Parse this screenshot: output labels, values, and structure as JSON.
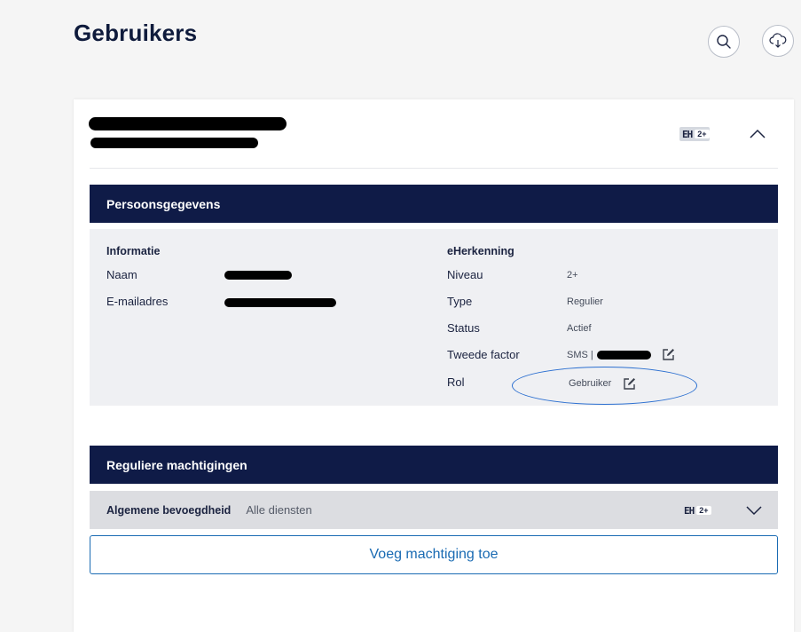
{
  "page": {
    "title": "Gebruikers"
  },
  "header_icons": {
    "search": "search-icon",
    "download": "cloud-download-icon"
  },
  "user_card": {
    "badge": {
      "eh": "EH",
      "level": "2+"
    }
  },
  "persoonsgegevens": {
    "heading": "Persoonsgegevens",
    "informatie": {
      "heading": "Informatie",
      "naam_label": "Naam",
      "email_label": "E-mailadres"
    },
    "eherkenning": {
      "heading": "eHerkenning",
      "niveau_label": "Niveau",
      "niveau_value": "2+",
      "type_label": "Type",
      "type_value": "Regulier",
      "status_label": "Status",
      "status_value": "Actief",
      "tweede_factor_label": "Tweede factor",
      "tweede_factor_value": "SMS |",
      "rol_label": "Rol",
      "rol_value": "Gebruiker"
    }
  },
  "machtigingen": {
    "heading": "Reguliere machtigingen",
    "items": [
      {
        "title": "Algemene bevoegdheid",
        "subtitle": "Alle diensten",
        "eh": "EH",
        "level": "2+"
      }
    ],
    "add_button": "Voeg machtiging toe"
  },
  "colors": {
    "navy": "#0f1b47",
    "accent": "#1a6bb3",
    "badge_bg": "#d5d9e0"
  }
}
